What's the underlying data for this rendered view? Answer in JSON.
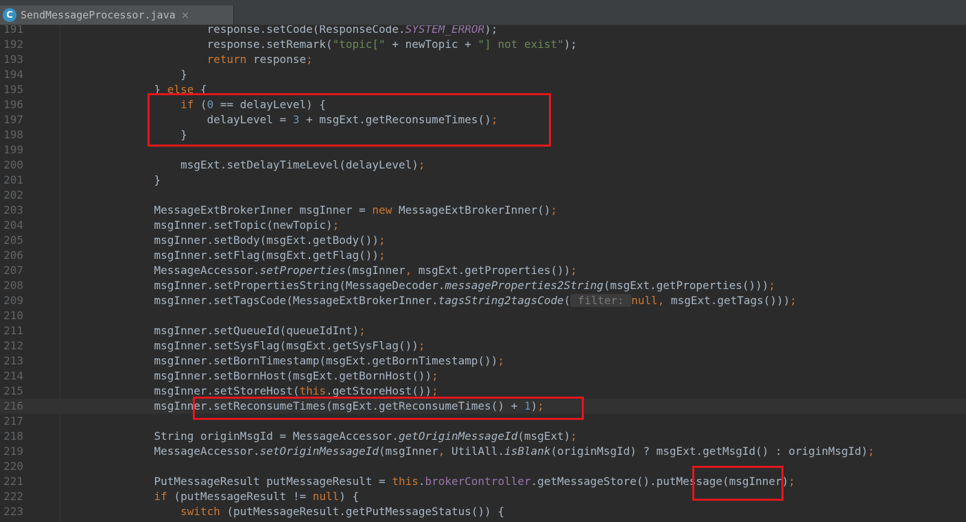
{
  "tab": {
    "filename": "SendMessageProcessor.java",
    "icon_letter": "C",
    "close_glyph": "×"
  },
  "lines": [
    {
      "n": "191",
      "indent": "            ",
      "tokens": [
        {
          "t": "response.setCode(ResponseCode.",
          "c": "plain"
        },
        {
          "t": "SYSTEM_ERROR",
          "c": "const"
        },
        {
          "t": ");",
          "c": "plain"
        }
      ]
    },
    {
      "n": "192",
      "indent": "            ",
      "tokens": [
        {
          "t": "response.setRemark(",
          "c": "plain"
        },
        {
          "t": "\"topic[\"",
          "c": "str"
        },
        {
          "t": " + newTopic + ",
          "c": "plain"
        },
        {
          "t": "\"] not exist\"",
          "c": "str"
        },
        {
          "t": ");",
          "c": "plain"
        }
      ]
    },
    {
      "n": "193",
      "indent": "            ",
      "tokens": [
        {
          "t": "return",
          "c": "kw"
        },
        {
          "t": " response",
          "c": "plain"
        },
        {
          "t": ";",
          "c": "punct"
        }
      ]
    },
    {
      "n": "194",
      "indent": "        ",
      "tokens": [
        {
          "t": "}",
          "c": "plain"
        }
      ]
    },
    {
      "n": "195",
      "indent": "    ",
      "tokens": [
        {
          "t": "} ",
          "c": "plain"
        },
        {
          "t": "else",
          "c": "kw"
        },
        {
          "t": " {",
          "c": "plain"
        }
      ]
    },
    {
      "n": "196",
      "indent": "        ",
      "tokens": [
        {
          "t": "if",
          "c": "kw"
        },
        {
          "t": " (",
          "c": "plain"
        },
        {
          "t": "0",
          "c": "num"
        },
        {
          "t": " == delayLevel) {",
          "c": "plain"
        }
      ]
    },
    {
      "n": "197",
      "indent": "            ",
      "tokens": [
        {
          "t": "delayLevel = ",
          "c": "plain"
        },
        {
          "t": "3",
          "c": "num"
        },
        {
          "t": " + msgExt.getReconsumeTimes()",
          "c": "plain"
        },
        {
          "t": ";",
          "c": "punct"
        }
      ]
    },
    {
      "n": "198",
      "indent": "        ",
      "tokens": [
        {
          "t": "}",
          "c": "plain"
        }
      ]
    },
    {
      "n": "199",
      "indent": "",
      "tokens": []
    },
    {
      "n": "200",
      "indent": "        ",
      "tokens": [
        {
          "t": "msgExt.setDelayTimeLevel(delayLevel)",
          "c": "plain"
        },
        {
          "t": ";",
          "c": "punct"
        }
      ]
    },
    {
      "n": "201",
      "indent": "    ",
      "tokens": [
        {
          "t": "}",
          "c": "plain"
        }
      ]
    },
    {
      "n": "202",
      "indent": "",
      "tokens": []
    },
    {
      "n": "203",
      "indent": "    ",
      "tokens": [
        {
          "t": "MessageExtBrokerInner msgInner = ",
          "c": "plain"
        },
        {
          "t": "new",
          "c": "kw"
        },
        {
          "t": " MessageExtBrokerInner()",
          "c": "plain"
        },
        {
          "t": ";",
          "c": "punct"
        }
      ]
    },
    {
      "n": "204",
      "indent": "    ",
      "tokens": [
        {
          "t": "msgInner.setTopic(newTopic)",
          "c": "plain"
        },
        {
          "t": ";",
          "c": "punct"
        }
      ]
    },
    {
      "n": "205",
      "indent": "    ",
      "tokens": [
        {
          "t": "msgInner.setBody(msgExt.getBody())",
          "c": "plain"
        },
        {
          "t": ";",
          "c": "punct"
        }
      ]
    },
    {
      "n": "206",
      "indent": "    ",
      "tokens": [
        {
          "t": "msgInner.setFlag(msgExt.getFlag())",
          "c": "plain"
        },
        {
          "t": ";",
          "c": "punct"
        }
      ]
    },
    {
      "n": "207",
      "indent": "    ",
      "tokens": [
        {
          "t": "MessageAccessor.",
          "c": "plain"
        },
        {
          "t": "setProperties",
          "c": "smethod"
        },
        {
          "t": "(msgInner",
          "c": "plain"
        },
        {
          "t": ",",
          "c": "punct"
        },
        {
          "t": " msgExt.getProperties())",
          "c": "plain"
        },
        {
          "t": ";",
          "c": "punct"
        }
      ]
    },
    {
      "n": "208",
      "indent": "    ",
      "tokens": [
        {
          "t": "msgInner.setPropertiesString(MessageDecoder.",
          "c": "plain"
        },
        {
          "t": "messageProperties2String",
          "c": "smethod"
        },
        {
          "t": "(msgExt.getProperties()))",
          "c": "plain"
        },
        {
          "t": ";",
          "c": "punct"
        }
      ]
    },
    {
      "n": "209",
      "indent": "    ",
      "tokens": [
        {
          "t": "msgInner.setTagsCode(MessageExtBrokerInner.",
          "c": "plain"
        },
        {
          "t": "tagsString2tagsCode",
          "c": "smethod"
        },
        {
          "t": "(",
          "c": "plain"
        },
        {
          "t": " filter: ",
          "c": "hint"
        },
        {
          "t": "null",
          "c": "kw"
        },
        {
          "t": ",",
          "c": "punct"
        },
        {
          "t": " msgExt.getTags()))",
          "c": "plain"
        },
        {
          "t": ";",
          "c": "punct"
        }
      ]
    },
    {
      "n": "210",
      "indent": "",
      "tokens": []
    },
    {
      "n": "211",
      "indent": "    ",
      "tokens": [
        {
          "t": "msgInner.setQueueId(queueIdInt)",
          "c": "plain"
        },
        {
          "t": ";",
          "c": "punct"
        }
      ]
    },
    {
      "n": "212",
      "indent": "    ",
      "tokens": [
        {
          "t": "msgInner.setSysFlag(msgExt.getSysFlag())",
          "c": "plain"
        },
        {
          "t": ";",
          "c": "punct"
        }
      ]
    },
    {
      "n": "213",
      "indent": "    ",
      "tokens": [
        {
          "t": "msgInner.setBornTimestamp(msgExt.getBornTimestamp())",
          "c": "plain"
        },
        {
          "t": ";",
          "c": "punct"
        }
      ]
    },
    {
      "n": "214",
      "indent": "    ",
      "tokens": [
        {
          "t": "msgInner.setBornHost(msgExt.getBornHost())",
          "c": "plain"
        },
        {
          "t": ";",
          "c": "punct"
        }
      ]
    },
    {
      "n": "215",
      "indent": "    ",
      "tokens": [
        {
          "t": "msgInner.setStoreHost(",
          "c": "plain"
        },
        {
          "t": "this",
          "c": "kw"
        },
        {
          "t": ".getStoreHost())",
          "c": "plain"
        },
        {
          "t": ";",
          "c": "punct"
        }
      ]
    },
    {
      "n": "216",
      "indent": "    ",
      "current": true,
      "tokens": [
        {
          "t": "msgInner.setReconsumeTimes(msgExt.getReconsumeTimes() + ",
          "c": "plain"
        },
        {
          "t": "1",
          "c": "num"
        },
        {
          "t": ")",
          "c": "plain"
        },
        {
          "t": ";",
          "c": "punct"
        }
      ]
    },
    {
      "n": "217",
      "indent": "",
      "tokens": []
    },
    {
      "n": "218",
      "indent": "    ",
      "tokens": [
        {
          "t": "String originMsgId = MessageAccessor.",
          "c": "plain"
        },
        {
          "t": "getOriginMessageId",
          "c": "smethod"
        },
        {
          "t": "(msgExt)",
          "c": "plain"
        },
        {
          "t": ";",
          "c": "punct"
        }
      ]
    },
    {
      "n": "219",
      "indent": "    ",
      "tokens": [
        {
          "t": "MessageAccessor.",
          "c": "plain"
        },
        {
          "t": "setOriginMessageId",
          "c": "smethod"
        },
        {
          "t": "(msgInner",
          "c": "plain"
        },
        {
          "t": ",",
          "c": "punct"
        },
        {
          "t": " UtilAll.",
          "c": "plain"
        },
        {
          "t": "isBlank",
          "c": "smethod"
        },
        {
          "t": "(originMsgId) ? msgExt.getMsgId() : originMsgId)",
          "c": "plain"
        },
        {
          "t": ";",
          "c": "punct"
        }
      ]
    },
    {
      "n": "220",
      "indent": "",
      "tokens": []
    },
    {
      "n": "221",
      "indent": "    ",
      "tokens": [
        {
          "t": "PutMessageResult putMessageResult = ",
          "c": "plain"
        },
        {
          "t": "this",
          "c": "kw"
        },
        {
          "t": ".",
          "c": "plain"
        },
        {
          "t": "brokerController",
          "c": "field"
        },
        {
          "t": ".getMessageStore().putMessage(msgInner)",
          "c": "plain"
        },
        {
          "t": ";",
          "c": "punct"
        }
      ]
    },
    {
      "n": "222",
      "indent": "    ",
      "tokens": [
        {
          "t": "if",
          "c": "kw"
        },
        {
          "t": " (putMessageResult != ",
          "c": "plain"
        },
        {
          "t": "null",
          "c": "kw"
        },
        {
          "t": ") {",
          "c": "plain"
        }
      ]
    },
    {
      "n": "223",
      "indent": "        ",
      "tokens": [
        {
          "t": "switch",
          "c": "kw"
        },
        {
          "t": " (putMessageResult.getPutMessageStatus()) {",
          "c": "plain"
        }
      ]
    }
  ],
  "highlight_color": "#e3171c"
}
